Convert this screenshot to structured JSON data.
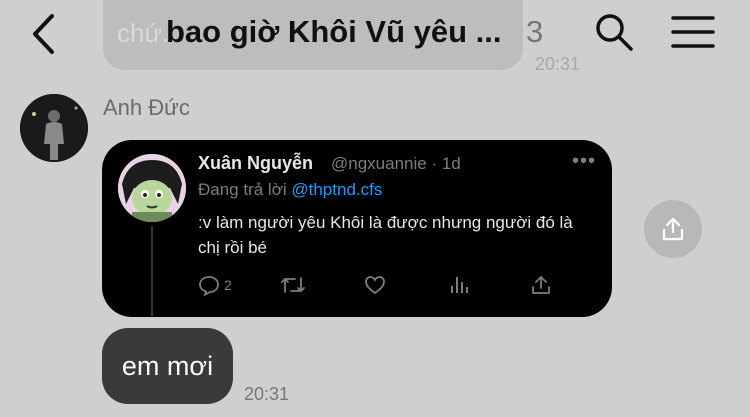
{
  "previous_message": {
    "text": "chứ...",
    "time": "20:31"
  },
  "header": {
    "title": "bao giờ Khôi Vũ yêu ...",
    "count": "3"
  },
  "sender": {
    "name": "Anh Đức"
  },
  "tweet": {
    "display_name": "Xuân Nguyễn",
    "handle_meta": "@ngxuannie · 1d",
    "more": "•••",
    "reply_prefix": "Đang trả lời",
    "reply_handle": "@thptnd.cfs",
    "text": ":v làm người yêu Khôi là được nhưng người đó là chị rồi bé",
    "reply_count": "2",
    "link_color": "#1d9bf0"
  },
  "message": {
    "text": "em mơi",
    "time": "20:31"
  },
  "icons": {
    "back": "chevron-left-icon",
    "search": "search-icon",
    "menu": "hamburger-menu-icon",
    "share": "share-icon"
  }
}
